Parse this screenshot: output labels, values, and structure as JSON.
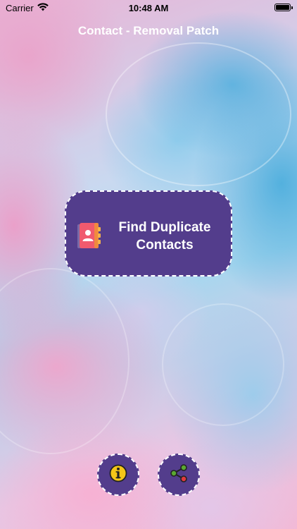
{
  "status_bar": {
    "carrier": "Carrier",
    "time": "10:48 AM",
    "wifi_icon": "wifi-icon",
    "battery_icon": "battery-icon"
  },
  "nav": {
    "title": "Contact - Removal Patch"
  },
  "main": {
    "find_duplicates_label": "Find Duplicate Contacts",
    "find_duplicates_icon": "contacts-book-icon"
  },
  "bottom_actions": {
    "info_icon": "info-icon",
    "share_icon": "share-icon"
  },
  "colors": {
    "button_fill": "#533d8c",
    "button_border": "#ffffff",
    "info_yellow": "#f5c518",
    "share_green": "#5aa832",
    "share_red": "#e0393e"
  }
}
